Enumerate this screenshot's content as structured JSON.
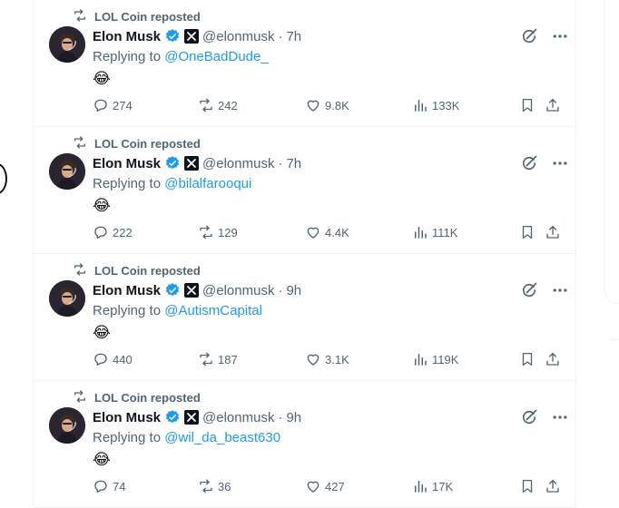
{
  "accent": "#1d9bf0",
  "muted": "#536471",
  "tweets": [
    {
      "repost_text": "LOL Coin reposted",
      "name": "Elon Musk",
      "handle": "@elonmusk",
      "dot": "·",
      "time": "7h",
      "replying_prefix": "Replying to",
      "mention": "@OneBadDude_",
      "emoji": "😂",
      "replies": "274",
      "reposts": "242",
      "likes": "9.8K",
      "views": "133K"
    },
    {
      "repost_text": "LOL Coin reposted",
      "name": "Elon Musk",
      "handle": "@elonmusk",
      "dot": "·",
      "time": "7h",
      "replying_prefix": "Replying to",
      "mention": "@bilalfarooqui",
      "emoji": "😂",
      "replies": "222",
      "reposts": "129",
      "likes": "4.4K",
      "views": "111K"
    },
    {
      "repost_text": "LOL Coin reposted",
      "name": "Elon Musk",
      "handle": "@elonmusk",
      "dot": "·",
      "time": "9h",
      "replying_prefix": "Replying to",
      "mention": "@AutismCapital",
      "emoji": "😂",
      "replies": "440",
      "reposts": "187",
      "likes": "3.1K",
      "views": "119K"
    },
    {
      "repost_text": "LOL Coin reposted",
      "name": "Elon Musk",
      "handle": "@elonmusk",
      "dot": "·",
      "time": "9h",
      "replying_prefix": "Replying to",
      "mention": "@wil_da_beast630",
      "emoji": "😂",
      "replies": "74",
      "reposts": "36",
      "likes": "427",
      "views": "17K"
    }
  ]
}
